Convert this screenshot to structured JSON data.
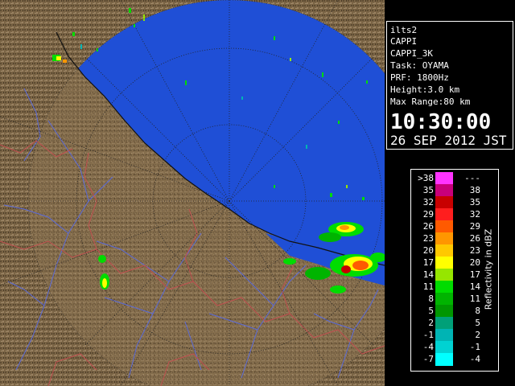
{
  "info": {
    "station": "ilts2",
    "product": "CAPPI",
    "product_code": "CAPPI_3K",
    "task": "Task: OYAMA",
    "prf": "PRF: 1800Hz",
    "height": "Height:3.0 km",
    "max_range": "Max Range:80 km",
    "time": "10:30:00",
    "date": "26 SEP 2012 JST"
  },
  "legend": {
    "title": "Reflectivity in dBZ",
    "rows": [
      {
        "lo": ">38",
        "hi": "---",
        "color": "#ff33ff"
      },
      {
        "lo": "35",
        "hi": "38",
        "color": "#c8007a"
      },
      {
        "lo": "32",
        "hi": "35",
        "color": "#c80000"
      },
      {
        "lo": "29",
        "hi": "32",
        "color": "#ff1e1e"
      },
      {
        "lo": "26",
        "hi": "29",
        "color": "#ff5a00"
      },
      {
        "lo": "23",
        "hi": "26",
        "color": "#ff9600"
      },
      {
        "lo": "20",
        "hi": "23",
        "color": "#ffc800"
      },
      {
        "lo": "17",
        "hi": "20",
        "color": "#ffff00"
      },
      {
        "lo": "14",
        "hi": "17",
        "color": "#96e600"
      },
      {
        "lo": "11",
        "hi": "14",
        "color": "#00dc00"
      },
      {
        "lo": "8",
        "hi": "11",
        "color": "#00b400"
      },
      {
        "lo": "5",
        "hi": "8",
        "color": "#009600"
      },
      {
        "lo": "2",
        "hi": "5",
        "color": "#00a078"
      },
      {
        "lo": "-1",
        "hi": "2",
        "color": "#00b4b4"
      },
      {
        "lo": "-4",
        "hi": "-1",
        "color": "#00d2d2"
      },
      {
        "lo": "-7",
        "hi": "-4",
        "color": "#00ffff"
      }
    ]
  },
  "map_colors": {
    "sea": "#1f4fd6",
    "land": "#7a6445",
    "rivers": "#5a6ad8",
    "borders": "#c05050",
    "range_ring": "#222222"
  }
}
